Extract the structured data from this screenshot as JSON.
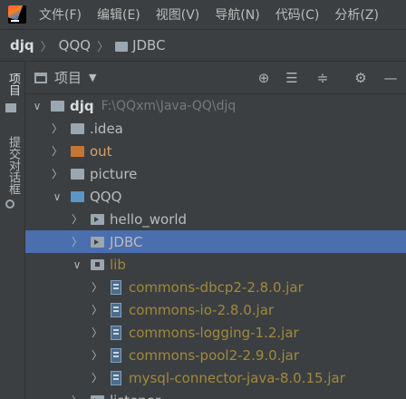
{
  "menubar": {
    "items": [
      "文件(F)",
      "编辑(E)",
      "视图(V)",
      "导航(N)",
      "代码(C)",
      "分析(Z)"
    ]
  },
  "navbar": {
    "crumbs": [
      "djq",
      "QQQ",
      "JDBC"
    ]
  },
  "sidebar": {
    "tabs": [
      "项目",
      "提交对话框"
    ]
  },
  "panel": {
    "title": "项目",
    "buttons": [
      "locate-icon",
      "expand-all-icon",
      "collapse-all-icon",
      "gear-icon",
      "hide-icon"
    ]
  },
  "tree": {
    "root_name": "djq",
    "root_path": "F:\\QQxm\\Java-QQ\\djq",
    "items": [
      {
        "label": "djq"
      },
      {
        "label": ".idea"
      },
      {
        "label": "out"
      },
      {
        "label": "picture"
      },
      {
        "label": "QQQ"
      },
      {
        "label": "hello_world"
      },
      {
        "label": "JDBC"
      },
      {
        "label": "lib"
      },
      {
        "label": "commons-dbcp2-2.8.0.jar"
      },
      {
        "label": "commons-io-2.8.0.jar"
      },
      {
        "label": "commons-logging-1.2.jar"
      },
      {
        "label": "commons-pool2-2.9.0.jar"
      },
      {
        "label": "mysql-connector-java-8.0.15.jar"
      },
      {
        "label": "listener"
      }
    ]
  }
}
